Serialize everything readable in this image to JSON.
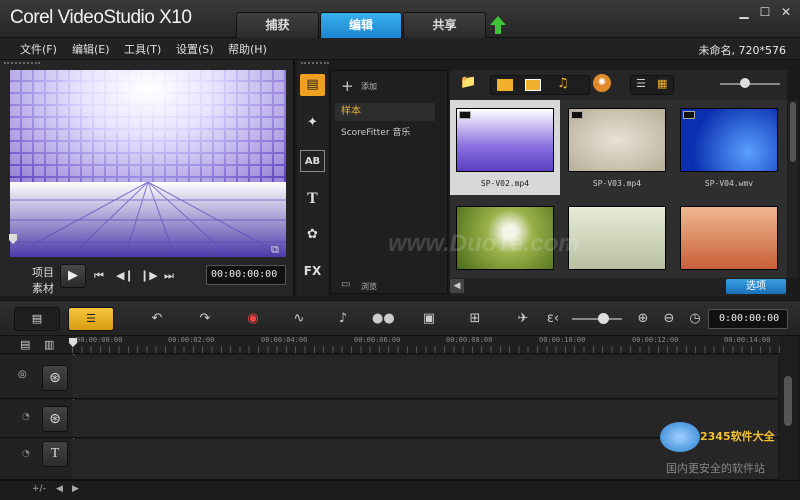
{
  "app": {
    "title": "Corel VideoStudio X10"
  },
  "tabs": [
    {
      "label": "捕获"
    },
    {
      "label": "编辑"
    },
    {
      "label": "共享"
    }
  ],
  "menu": [
    "文件(F)",
    "编辑(E)",
    "工具(T)",
    "设置(S)",
    "帮助(H)"
  ],
  "project_info": "未命名, 720*576",
  "preview": {
    "mode_project": "项目",
    "mode_clip": "素材",
    "timecode": "00:00:00:00"
  },
  "library": {
    "add_label": "添加",
    "folders": [
      {
        "label": "样本"
      },
      {
        "label": "ScoreFitter 音乐"
      }
    ],
    "browse_label": "浏览",
    "options_label": "选项",
    "thumbnails": [
      {
        "caption": "SP-V02.mp4"
      },
      {
        "caption": "SP-V03.mp4"
      },
      {
        "caption": "SP-V04.wmv"
      },
      {
        "caption": ""
      },
      {
        "caption": ""
      },
      {
        "caption": ""
      }
    ]
  },
  "timeline": {
    "timecode": "0:00:00:00",
    "ruler_labels": [
      "00:00:00:00",
      "00:00:02:00",
      "00:00:04:00",
      "00:00:06:00",
      "00:00:08:00",
      "00:00:10:00",
      "00:00:12:00",
      "00:00:14:00"
    ]
  },
  "watermark": "www.DuoTe.com",
  "badge": {
    "brand": "2345软件大全",
    "slogan": "国内更安全的软件站"
  },
  "colors": {
    "accent": "#2a9be0",
    "background": "#1b1b1b"
  }
}
